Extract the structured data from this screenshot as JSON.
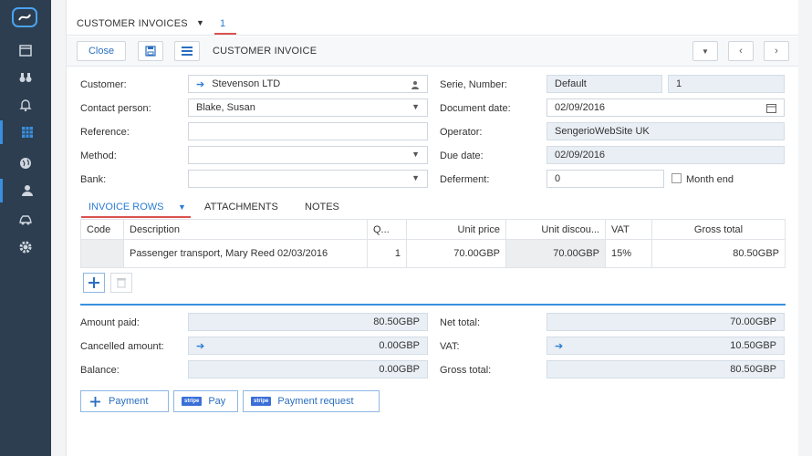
{
  "sidebar": {
    "items": [
      {
        "icon": "calendar-icon"
      },
      {
        "icon": "binoculars-icon"
      },
      {
        "icon": "bell-icon"
      },
      {
        "icon": "spreadsheet-icon",
        "active": true
      },
      {
        "icon": "globe-icon"
      },
      {
        "icon": "user-icon"
      },
      {
        "icon": "car-icon"
      },
      {
        "icon": "gear-icon"
      }
    ]
  },
  "tabbar": {
    "title": "CUSTOMER INVOICES",
    "count": "1"
  },
  "toolbar": {
    "close_label": "Close",
    "title": "CUSTOMER INVOICE"
  },
  "form": {
    "customer_label": "Customer:",
    "customer_value": "Stevenson LTD",
    "contact_label": "Contact person:",
    "contact_value": "Blake, Susan",
    "reference_label": "Reference:",
    "reference_value": "",
    "method_label": "Method:",
    "method_value": "",
    "bank_label": "Bank:",
    "bank_value": "",
    "serie_label": "Serie, Number:",
    "serie_value": "Default",
    "number_value": "1",
    "docdate_label": "Document date:",
    "docdate_value": "02/09/2016",
    "operator_label": "Operator:",
    "operator_value": "SengerioWebSite UK",
    "duedate_label": "Due date:",
    "duedate_value": "02/09/2016",
    "deferment_label": "Deferment:",
    "deferment_value": "0",
    "monthend_label": "Month end"
  },
  "subtabs": {
    "invoice_rows": "INVOICE ROWS",
    "attachments": "ATTACHMENTS",
    "notes": "NOTES"
  },
  "rows": {
    "headers": [
      "Code",
      "Description",
      "Q...",
      "Unit price",
      "Unit discou...",
      "VAT",
      "Gross total"
    ],
    "items": [
      {
        "code": "",
        "description": "Passenger transport, Mary Reed 02/03/2016",
        "qty": "1",
        "unit_price": "70.00GBP",
        "unit_discount": "70.00GBP",
        "vat": "15%",
        "gross": "80.50GBP"
      }
    ]
  },
  "summary": {
    "amount_paid_label": "Amount paid:",
    "amount_paid": "80.50GBP",
    "cancelled_label": "Cancelled amount:",
    "cancelled": "0.00GBP",
    "balance_label": "Balance:",
    "balance": "0.00GBP",
    "net_total_label": "Net total:",
    "net_total": "70.00GBP",
    "vat_label": "VAT:",
    "vat": "10.50GBP",
    "gross_total_label": "Gross total:",
    "gross_total": "80.50GBP"
  },
  "actions": {
    "payment": "Payment",
    "pay": "Pay",
    "payment_request": "Payment request",
    "stripe_badge": "stripe"
  },
  "colors": {
    "sidebar": "#2c3e50",
    "accent": "#2a7bd4",
    "underline": "#d9534f"
  }
}
